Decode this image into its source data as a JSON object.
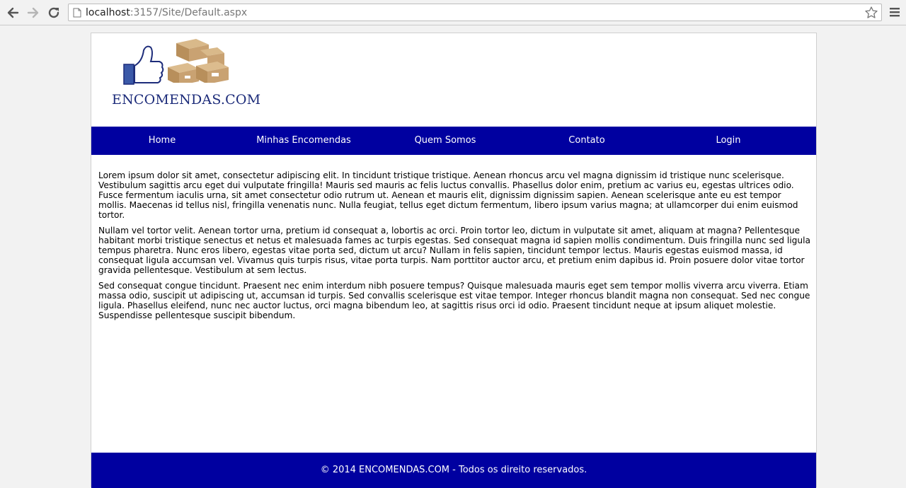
{
  "browser": {
    "url_host": "localhost",
    "url_rest": ":3157/Site/Default.aspx"
  },
  "site": {
    "logo_text": "ENCOMENDAS.COM",
    "nav": [
      "Home",
      "Minhas Encomendas",
      "Quem Somos",
      "Contato",
      "Login"
    ],
    "paragraphs": [
      "Lorem ipsum dolor sit amet, consectetur adipiscing elit. In tincidunt tristique tristique. Aenean rhoncus arcu vel magna dignissim id tristique nunc scelerisque. Vestibulum sagittis arcu eget dui vulputate fringilla! Mauris sed mauris ac felis luctus convallis. Phasellus dolor enim, pretium ac varius eu, egestas ultrices odio. Fusce fermentum iaculis urna, sit amet consectetur odio rutrum ut. Aenean et mauris elit, dignissim dignissim sapien. Aenean scelerisque ante eu est tempor mollis. Maecenas id tellus nisl, fringilla venenatis nunc. Nulla feugiat, tellus eget dictum fermentum, libero ipsum varius magna; at ullamcorper dui enim euismod tortor.",
      "Nullam vel tortor velit. Aenean tortor urna, pretium id consequat a, lobortis ac orci. Proin tortor leo, dictum in vulputate sit amet, aliquam at magna? Pellentesque habitant morbi tristique senectus et netus et malesuada fames ac turpis egestas. Sed consequat magna id sapien mollis condimentum. Duis fringilla nunc sed ligula tempus pharetra. Nunc eros libero, egestas vitae porta sed, dictum ut arcu? Nullam in felis sapien, tincidunt tempor lectus. Mauris egestas euismod massa, id consequat ligula accumsan vel. Vivamus quis turpis risus, vitae porta turpis. Nam porttitor auctor arcu, et pretium enim dapibus id. Proin posuere dolor vitae tortor gravida pellentesque. Vestibulum at sem lectus.",
      "Sed consequat congue tincidunt. Praesent nec enim interdum nibh posuere tempus? Quisque malesuada mauris eget sem tempor mollis viverra arcu viverra. Etiam massa odio, suscipit ut adipiscing ut, accumsan id turpis. Sed convallis scelerisque est vitae tempor. Integer rhoncus blandit magna non consequat. Sed nec congue ligula. Phasellus eleifend, nunc nec auctor luctus, orci magna bibendum leo, at sagittis risus orci id odio. Praesent tincidunt neque at ipsum aliquet molestie. Suspendisse pellentesque suscipit bibendum."
    ],
    "footer": "© 2014 ENCOMENDAS.COM - Todos os direito reservados."
  },
  "colors": {
    "nav_bg": "#0000a0",
    "logo_text": "#1d2c7a",
    "page_bg": "#f2f2f2"
  },
  "icons": [
    "back-arrow-icon",
    "forward-arrow-icon",
    "reload-icon",
    "page-icon",
    "star-icon",
    "menu-icon",
    "thumbs-up-icon",
    "boxes-icon"
  ]
}
